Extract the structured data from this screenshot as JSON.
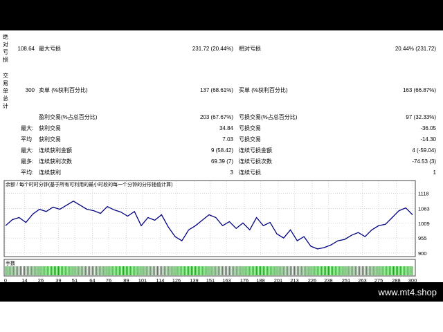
{
  "side_labels": {
    "abs_drawdown": "绝对亏损",
    "total_trades": "交易单总计"
  },
  "rows": {
    "r1": {
      "v0": "108.64",
      "l1": "最大亏损",
      "v1": "231.72 (20.44%)",
      "l2": "相对亏损",
      "v2": "20.44% (231.72)"
    },
    "r2": {
      "v0": "300",
      "l1": "卖单 (%获利百分比)",
      "v1": "137 (68.61%)",
      "l2": "买单 (%获利百分比)",
      "v2": "163 (66.87%)"
    },
    "r3": {
      "l1": "盈利交易(%占总百分比)",
      "v1": "203 (67.67%)",
      "l2": "亏损交易(%占总百分比)",
      "v2": "97 (32.33%)"
    },
    "r4": {
      "p": "最大:",
      "l1": "获利交易",
      "v1": "34.84",
      "l2": "亏损交易",
      "v2": "-36.05"
    },
    "r5": {
      "p": "平均",
      "l1": "获利交易",
      "v1": "7.03",
      "l2": "亏损交易",
      "v2": "-14.30"
    },
    "r6": {
      "p": "最大:",
      "l1": "连续获利金额",
      "v1": "9 (58.42)",
      "l2": "连续亏损金额",
      "v2": "4 (-59.04)"
    },
    "r7": {
      "p": "最多:",
      "l1": "连续获利次数",
      "v1": "69.39 (7)",
      "l2": "连续亏损次数",
      "v2": "-74.53 (3)"
    },
    "r8": {
      "p": "平均:",
      "l1": "连续获利",
      "v1": "3",
      "l2": "连续亏损",
      "v2": "1"
    }
  },
  "chart_title": "余额 / 每个时时分钟(基于所有可利用的最小时段的每一个分钟的分形插值计算)",
  "volume_label": "手数",
  "watermark": "www.mt4.shop",
  "chart_data": {
    "type": "line",
    "title": "余额 / 每个时时分钟(基于所有可利用的最小时段的每一个分钟的分形插值计算)",
    "ylim": [
      892,
      1140
    ],
    "y_ticks": [
      1118,
      1063,
      1009,
      955,
      900
    ],
    "x_ticks": [
      0,
      14,
      26,
      39,
      51,
      64,
      76,
      89,
      101,
      114,
      126,
      139,
      151,
      163,
      176,
      188,
      201,
      213,
      226,
      238,
      251,
      263,
      275,
      288,
      300
    ],
    "x": [
      0,
      5,
      10,
      15,
      20,
      25,
      30,
      35,
      40,
      45,
      50,
      55,
      60,
      65,
      70,
      75,
      80,
      85,
      90,
      95,
      100,
      105,
      110,
      115,
      120,
      125,
      130,
      135,
      140,
      145,
      150,
      155,
      160,
      165,
      170,
      175,
      180,
      185,
      190,
      195,
      200,
      205,
      210,
      215,
      220,
      225,
      230,
      235,
      240,
      245,
      250,
      255,
      260,
      265,
      270,
      275,
      280,
      285,
      290,
      295,
      300
    ],
    "values": [
      1000,
      1022,
      1030,
      1012,
      1042,
      1060,
      1052,
      1068,
      1060,
      1075,
      1090,
      1075,
      1060,
      1055,
      1045,
      1070,
      1058,
      1050,
      1035,
      1052,
      1000,
      1030,
      1020,
      1040,
      995,
      960,
      945,
      985,
      1000,
      1020,
      1040,
      1030,
      1000,
      1015,
      990,
      1010,
      985,
      1030,
      1000,
      1012,
      970,
      955,
      985,
      945,
      960,
      925,
      915,
      920,
      930,
      945,
      950,
      965,
      975,
      960,
      985,
      1000,
      1005,
      1030,
      1055,
      1065,
      1040
    ]
  }
}
